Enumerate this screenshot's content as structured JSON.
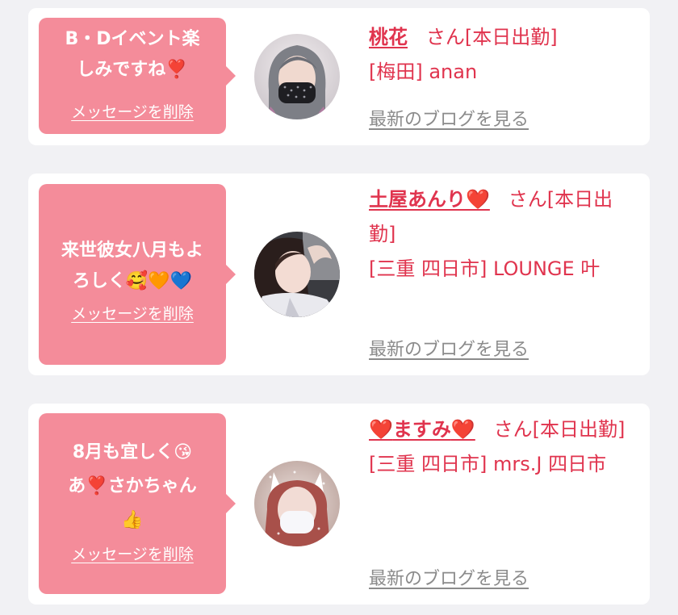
{
  "messages": [
    {
      "bubble_text": "B・Dイベント楽\nしみですね❣️",
      "delete_label": "メッセージを削除",
      "name": "桃花",
      "name_prefix_heart": "",
      "name_suffix_heart": "",
      "status": "さん[本日出勤]",
      "shop": "[梅田] anan",
      "blog_link": "最新のブログを見る"
    },
    {
      "bubble_text": "来世彼女八月もよ\nろしく🥰🧡💙",
      "delete_label": "メッセージを削除",
      "name": "土屋あんり",
      "name_prefix_heart": "",
      "name_suffix_heart": "❤️",
      "status": "さん[本日出勤]",
      "shop": "[三重 四日市] LOUNGE 叶",
      "blog_link": "最新のブログを見る"
    },
    {
      "bubble_text": "8月も宜しく😘\nあ❣️さかちゃん\n👍",
      "delete_label": "メッセージを削除",
      "name": "ますみ",
      "name_prefix_heart": "❤️",
      "name_suffix_heart": "❤️",
      "status": "さん[本日出勤]",
      "shop": "[三重 四日市] mrs.J 四日市",
      "blog_link": "最新のブログを見る"
    }
  ],
  "colors": {
    "bubble": "#f48c9a",
    "accent_text": "#e0344e",
    "link_gray": "#8b8b8b",
    "background": "#f1f1f4"
  }
}
